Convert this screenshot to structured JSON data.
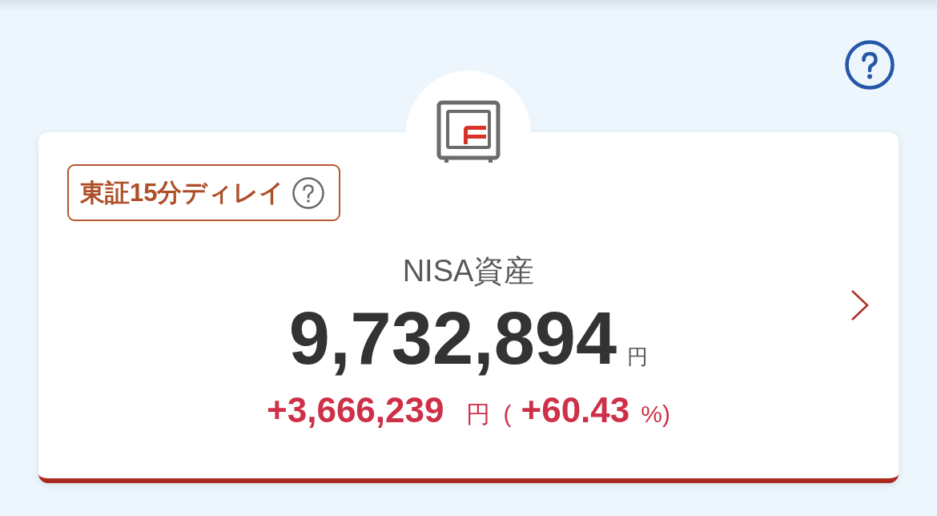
{
  "asset_card": {
    "delay_button": {
      "label": "東証15分ディレイ"
    },
    "title": "NISA資産",
    "total": {
      "amount": "9,732,894",
      "unit": "円"
    },
    "change": {
      "amount": "+3,666,239",
      "unit": "円",
      "open": "(",
      "rate": "+60.43",
      "percent": "%",
      "close": ")"
    }
  }
}
